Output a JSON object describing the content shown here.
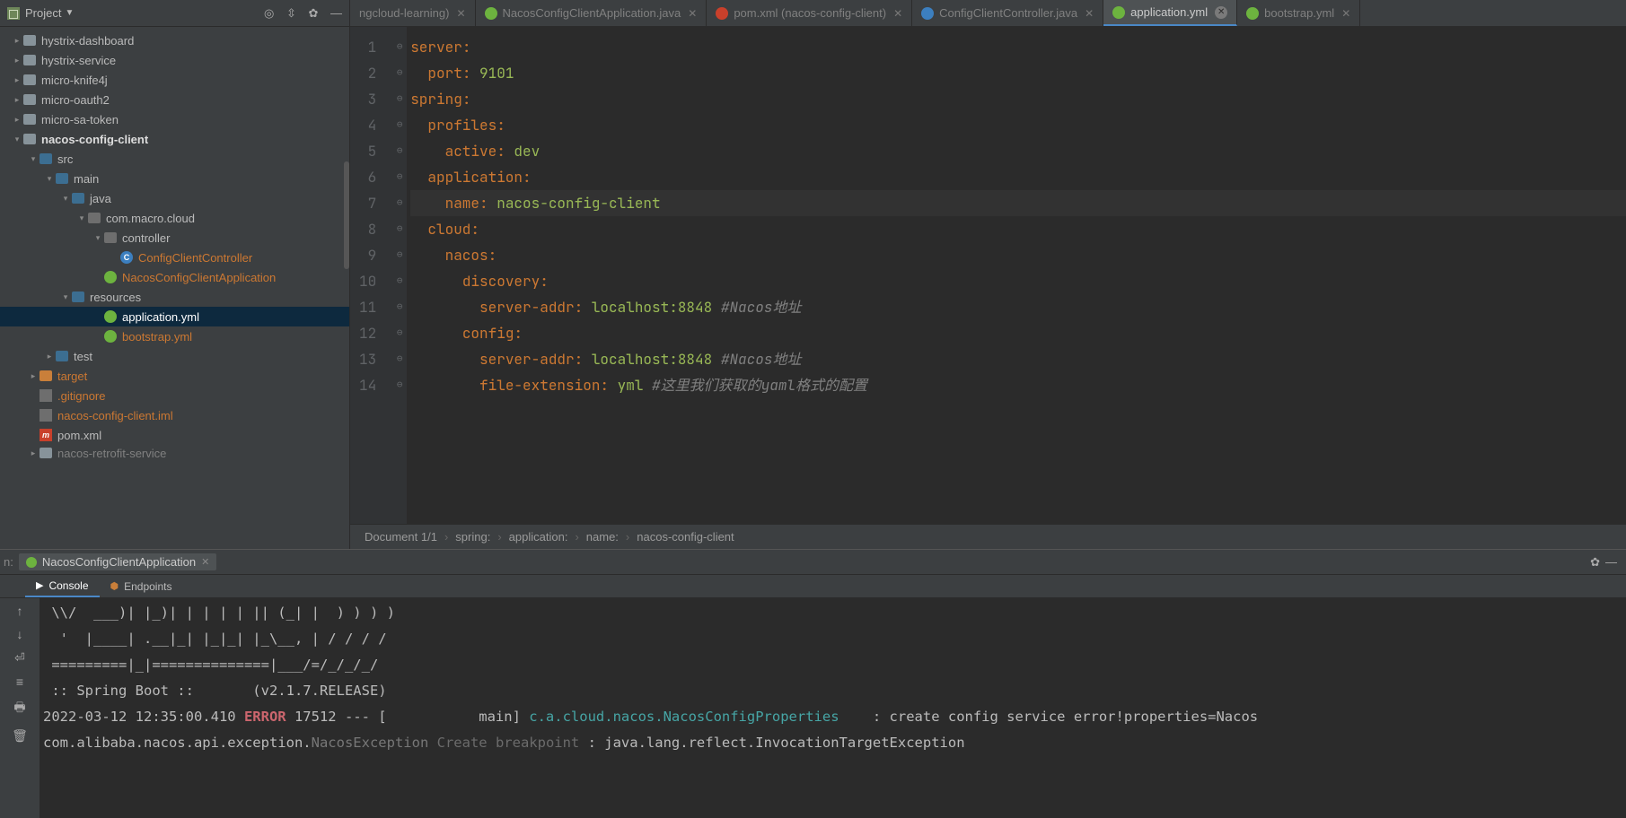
{
  "project": {
    "label": "Project"
  },
  "tabs": [
    {
      "label": "ngcloud-learning)",
      "iconColor": "",
      "active": false
    },
    {
      "label": "NacosConfigClientApplication.java",
      "iconColor": "#6db33f",
      "active": false
    },
    {
      "label": "pom.xml (nacos-config-client)",
      "iconColor": "#c9402b",
      "active": false
    },
    {
      "label": "ConfigClientController.java",
      "iconColor": "#3c7fbf",
      "active": false
    },
    {
      "label": "application.yml",
      "iconColor": "#6db33f",
      "active": true
    },
    {
      "label": "bootstrap.yml",
      "iconColor": "#6db33f",
      "active": false
    }
  ],
  "tree": {
    "items": [
      {
        "indent": 0,
        "arrow": "right",
        "icon": "folder",
        "label": "hystrix-dashboard"
      },
      {
        "indent": 0,
        "arrow": "right",
        "icon": "folder",
        "label": "hystrix-service"
      },
      {
        "indent": 0,
        "arrow": "right",
        "icon": "folder",
        "label": "micro-knife4j"
      },
      {
        "indent": 0,
        "arrow": "right",
        "icon": "folder",
        "label": "micro-oauth2"
      },
      {
        "indent": 0,
        "arrow": "right",
        "icon": "folder",
        "label": "micro-sa-token"
      },
      {
        "indent": 0,
        "arrow": "down",
        "icon": "folder-open",
        "label": "nacos-config-client",
        "bold": true
      },
      {
        "indent": 1,
        "arrow": "down",
        "icon": "folder-blue",
        "label": "src"
      },
      {
        "indent": 2,
        "arrow": "down",
        "icon": "folder-blue",
        "label": "main"
      },
      {
        "indent": 3,
        "arrow": "down",
        "icon": "folder-blue",
        "label": "java"
      },
      {
        "indent": 4,
        "arrow": "down",
        "icon": "pkg",
        "label": "com.macro.cloud"
      },
      {
        "indent": 5,
        "arrow": "down",
        "icon": "pkg",
        "label": "controller"
      },
      {
        "indent": 6,
        "arrow": "none",
        "icon": "file-c",
        "label": "ConfigClientController",
        "orange": true
      },
      {
        "indent": 5,
        "arrow": "none",
        "icon": "file-spring",
        "label": "NacosConfigClientApplication",
        "orange": true
      },
      {
        "indent": 3,
        "arrow": "down",
        "icon": "folder-blue",
        "label": "resources"
      },
      {
        "indent": 5,
        "arrow": "none",
        "icon": "file-spring",
        "label": "application.yml",
        "orange": true,
        "selected": true
      },
      {
        "indent": 5,
        "arrow": "none",
        "icon": "file-spring",
        "label": "bootstrap.yml",
        "orange": true
      },
      {
        "indent": 2,
        "arrow": "right",
        "icon": "folder-blue",
        "label": "test"
      },
      {
        "indent": 1,
        "arrow": "right",
        "icon": "folder-orange",
        "label": "target",
        "orange": true
      },
      {
        "indent": 1,
        "arrow": "none",
        "icon": "file-git",
        "label": ".gitignore",
        "orange": true
      },
      {
        "indent": 1,
        "arrow": "none",
        "icon": "file-git",
        "label": "nacos-config-client.iml",
        "orange": true
      },
      {
        "indent": 1,
        "arrow": "none",
        "icon": "file-m",
        "label": "pom.xml"
      }
    ],
    "cutoff": "nacos-retrofit-service"
  },
  "editor": {
    "lines": [
      {
        "n": 1,
        "seg": [
          [
            "k",
            "server"
          ],
          [
            "colon",
            ":"
          ]
        ]
      },
      {
        "n": 2,
        "seg": [
          [
            "s",
            "  "
          ],
          [
            "k",
            "port"
          ],
          [
            "colon",
            ": "
          ],
          [
            "v",
            "9101"
          ]
        ]
      },
      {
        "n": 3,
        "seg": [
          [
            "k",
            "spring"
          ],
          [
            "colon",
            ":"
          ]
        ]
      },
      {
        "n": 4,
        "seg": [
          [
            "s",
            "  "
          ],
          [
            "k",
            "profiles"
          ],
          [
            "colon",
            ":"
          ]
        ]
      },
      {
        "n": 5,
        "seg": [
          [
            "s",
            "    "
          ],
          [
            "k",
            "active"
          ],
          [
            "colon",
            ": "
          ],
          [
            "v",
            "dev"
          ]
        ]
      },
      {
        "n": 6,
        "seg": [
          [
            "s",
            "  "
          ],
          [
            "k",
            "application"
          ],
          [
            "colon",
            ":"
          ]
        ]
      },
      {
        "n": 7,
        "seg": [
          [
            "s",
            "    "
          ],
          [
            "k",
            "name"
          ],
          [
            "colon",
            ": "
          ],
          [
            "v",
            "nacos-config-client"
          ]
        ],
        "current": true
      },
      {
        "n": 8,
        "seg": [
          [
            "s",
            "  "
          ],
          [
            "k",
            "cloud"
          ],
          [
            "colon",
            ":"
          ]
        ]
      },
      {
        "n": 9,
        "seg": [
          [
            "s",
            "    "
          ],
          [
            "k",
            "nacos"
          ],
          [
            "colon",
            ":"
          ]
        ]
      },
      {
        "n": 10,
        "seg": [
          [
            "s",
            "      "
          ],
          [
            "k",
            "discovery"
          ],
          [
            "colon",
            ":"
          ]
        ]
      },
      {
        "n": 11,
        "seg": [
          [
            "s",
            "        "
          ],
          [
            "k",
            "server-addr"
          ],
          [
            "colon",
            ": "
          ],
          [
            "v",
            "localhost:8848 "
          ],
          [
            "c",
            "#Nacos地址"
          ]
        ]
      },
      {
        "n": 12,
        "seg": [
          [
            "s",
            "      "
          ],
          [
            "k",
            "config"
          ],
          [
            "colon",
            ":"
          ]
        ]
      },
      {
        "n": 13,
        "seg": [
          [
            "s",
            "        "
          ],
          [
            "k",
            "server-addr"
          ],
          [
            "colon",
            ": "
          ],
          [
            "v",
            "localhost:8848 "
          ],
          [
            "c",
            "#Nacos地址"
          ]
        ]
      },
      {
        "n": 14,
        "seg": [
          [
            "s",
            "        "
          ],
          [
            "k",
            "file-extension"
          ],
          [
            "colon",
            ": "
          ],
          [
            "v",
            "yml "
          ],
          [
            "c",
            "#这里我们获取的yaml格式的配置"
          ]
        ]
      }
    ]
  },
  "breadcrumb": [
    "Document 1/1",
    "spring:",
    "application:",
    "name:",
    "nacos-config-client"
  ],
  "run": {
    "label": "n:",
    "app": "NacosConfigClientApplication",
    "tabs": {
      "console": "Console",
      "endpoints": "Endpoints"
    },
    "console_lines": [
      " \\\\/  ___)| |_)| | | | | || (_| |  ) ) ) )",
      "  '  |____| .__|_| |_|_| |_\\__, | / / / /",
      " =========|_|==============|___/=/_/_/_/",
      " :: Spring Boot ::       (v2.1.7.RELEASE)",
      "",
      "2022-03-12 12:35:00.410 ERROR 17512 --- [           main] c.a.cloud.nacos.NacosConfigProperties    : create config service error!properties=Nacos",
      "",
      "com.alibaba.nacos.api.exception.NacosException Create breakpoint : java.lang.reflect.InvocationTargetException"
    ]
  }
}
